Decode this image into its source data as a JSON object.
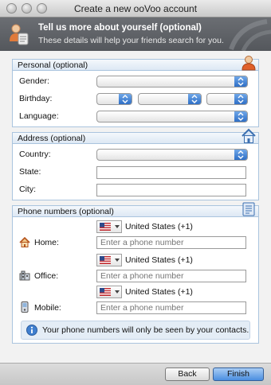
{
  "window": {
    "title": "Create a new ooVoo account"
  },
  "banner": {
    "title": "Tell us more about yourself (optional)",
    "subtitle": "These details will help your friends search for you."
  },
  "personal": {
    "title": "Personal (optional)",
    "gender_label": "Gender:",
    "birthday_label": "Birthday:",
    "language_label": "Language:"
  },
  "address": {
    "title": "Address (optional)",
    "country_label": "Country:",
    "state_label": "State:",
    "city_label": "City:"
  },
  "phones": {
    "title": "Phone numbers (optional)",
    "rows": [
      {
        "label": "Home:",
        "country": "United States (+1)",
        "placeholder": "Enter a phone number"
      },
      {
        "label": "Office:",
        "country": "United States (+1)",
        "placeholder": "Enter a phone number"
      },
      {
        "label": "Mobile:",
        "country": "United States (+1)",
        "placeholder": "Enter a phone number"
      }
    ],
    "info": "Your phone numbers will only be seen by your contacts."
  },
  "footer": {
    "back_label": "Back",
    "finish_label": "Finish"
  },
  "colors": {
    "accent": "#4a8ee0",
    "section_border": "#aac4de",
    "banner": "#5f6267"
  }
}
